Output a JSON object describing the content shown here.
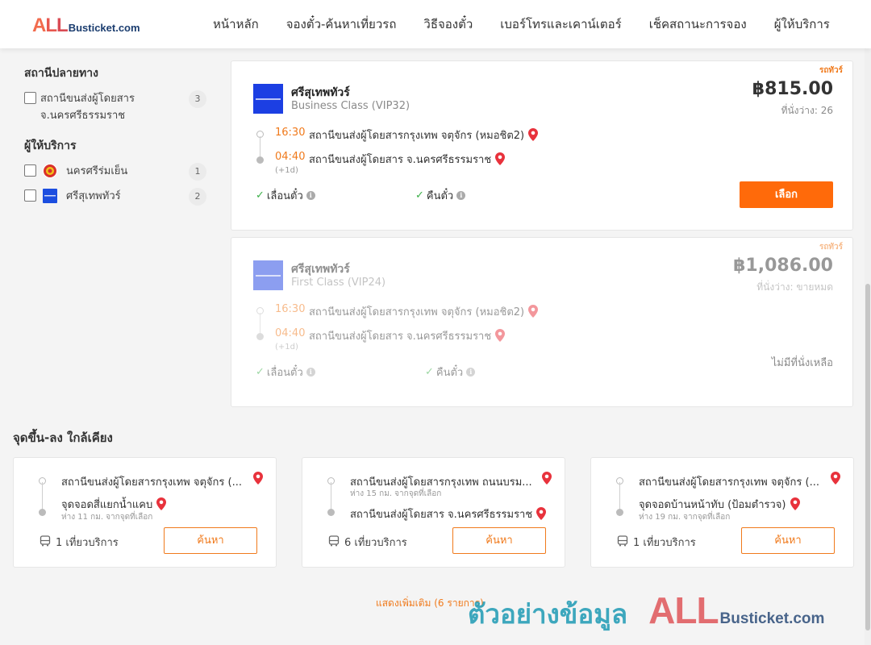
{
  "header": {
    "logo_all": "ALL",
    "logo_rest": "Busticket.com",
    "nav": [
      "หน้าหลัก",
      "จองตั๋ว-ค้นหาเที่ยวรถ",
      "วิธีจองตั๋ว",
      "เบอร์โทรและเคาน์เตอร์",
      "เช็คสถานะการจอง",
      "ผู้ให้บริการ"
    ]
  },
  "sidebar": {
    "destination_title": "สถานีปลายทาง",
    "destinations": [
      {
        "label": "สถานีขนส่งผู้โดยสาร จ.นครศรีธรรมราช",
        "count": "3"
      }
    ],
    "operators_title": "ผู้ให้บริการ",
    "operators": [
      {
        "label": "นครศรีร่มเย็น",
        "count": "1",
        "icon": "red-seal-icon"
      },
      {
        "label": "ศรีสุเทพทัวร์",
        "count": "2",
        "icon": "blue-logo-icon"
      }
    ]
  },
  "trips": [
    {
      "badge": "รถทัวร์",
      "operator": "ศรีสุเทพทัวร์",
      "bus_class": "Business Class (VIP32)",
      "price": "฿815.00",
      "seats": "ที่นั่งว่าง: 26",
      "depart_time": "16:30",
      "depart_stop": "สถานีขนส่งผู้โดยสารกรุงเทพ จตุจักร (หมอชิต2)",
      "arrive_time": "04:40",
      "arrive_stop": "สถานีขนส่งผู้โดยสาร จ.นครศรีธรรมราช",
      "next_day": "(+1d)",
      "policy_change": "เลื่อนตั๋ว",
      "policy_refund": "คืนตั๋ว",
      "select_label": "เลือก"
    },
    {
      "badge": "รถทัวร์",
      "operator": "ศรีสุเทพทัวร์",
      "bus_class": "First Class (VIP24)",
      "price": "฿1,086.00",
      "seats": "ที่นั่งว่าง: ขายหมด",
      "depart_time": "16:30",
      "depart_stop": "สถานีขนส่งผู้โดยสารกรุงเทพ จตุจักร (หมอชิต2)",
      "arrive_time": "04:40",
      "arrive_stop": "สถานีขนส่งผู้โดยสาร จ.นครศรีธรรมราช",
      "next_day": "(+1d)",
      "policy_change": "เลื่อนตั๋ว",
      "policy_refund": "คืนตั๋ว",
      "soldout_label": "ไม่มีที่นั่งเหลือ"
    }
  ],
  "nearby": {
    "title": "จุดขึ้น-ลง ใกล้เคียง",
    "cards": [
      {
        "from": "สถานีขนส่งผู้โดยสารกรุงเทพ จตุจักร (...",
        "from_note": "",
        "to": "จุดจอดสี่แยกน้ำแคบ",
        "to_note": "ห่าง 11 กม. จากจุดที่เลือก",
        "trips": "1 เที่ยวบริการ",
        "search_label": "ค้นหา"
      },
      {
        "from": "สถานีขนส่งผู้โดยสารกรุงเทพ ถนนบรม...",
        "from_note": "ห่าง 15 กม. จากจุดที่เลือก",
        "to": "สถานีขนส่งผู้โดยสาร จ.นครศรีธรรมราช",
        "to_note": "",
        "trips": "6 เที่ยวบริการ",
        "search_label": "ค้นหา"
      },
      {
        "from": "สถานีขนส่งผู้โดยสารกรุงเทพ จตุจักร (...",
        "from_note": "",
        "to": "จุดจอดบ้านหน้าทับ (ป้อมตำรวจ)",
        "to_note": "ห่าง 19 กม. จากจุดที่เลือก",
        "trips": "1 เที่ยวบริการ",
        "search_label": "ค้นหา"
      }
    ],
    "more_label": "แสดงเพิ่มเติม (6 รายการ)"
  },
  "watermark": {
    "thai": "ตัวอย่างข้อมูล",
    "all": "ALL",
    "rest": "Busticket.com"
  },
  "colors": {
    "accent": "#ff6a0a",
    "time": "#f07a1c",
    "check": "#3cb049",
    "pin": "#e8323c"
  }
}
